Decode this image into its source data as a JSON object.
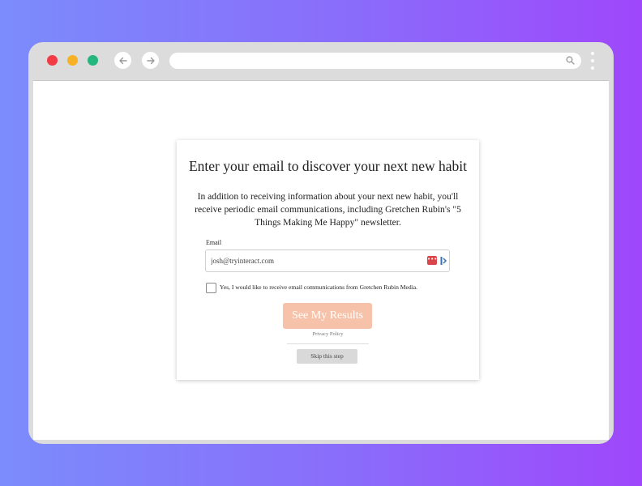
{
  "browser": {
    "window_controls": {
      "close_color": "#f23b45",
      "minimize_color": "#f8b125",
      "maximize_color": "#25b67e"
    },
    "nav": {
      "back_icon": "arrow-left-icon",
      "forward_icon": "arrow-right-icon"
    },
    "address_bar": {
      "value": "",
      "search_icon": "search-icon"
    },
    "menu_icon": "kebab-menu-icon"
  },
  "form": {
    "heading": "Enter your email to discover your next new habit",
    "description": "In addition to receiving information about your next new habit, you'll receive periodic email communications, including Gretchen Rubin's \"5 Things Making Me Happy\" newsletter.",
    "email_label": "Email",
    "email_value": "josh@tryinteract.com",
    "password_manager_icon": "password-manager-icon",
    "extension_icon": "extension-icon",
    "consent_checked": false,
    "consent_text": "Yes, I would like to receive email communications from Gretchen Rubin Media.",
    "submit_label": "See My Results",
    "submit_color": "#f6c2a9",
    "privacy_link": "Privacy Policy",
    "skip_label": "Skip this step"
  }
}
